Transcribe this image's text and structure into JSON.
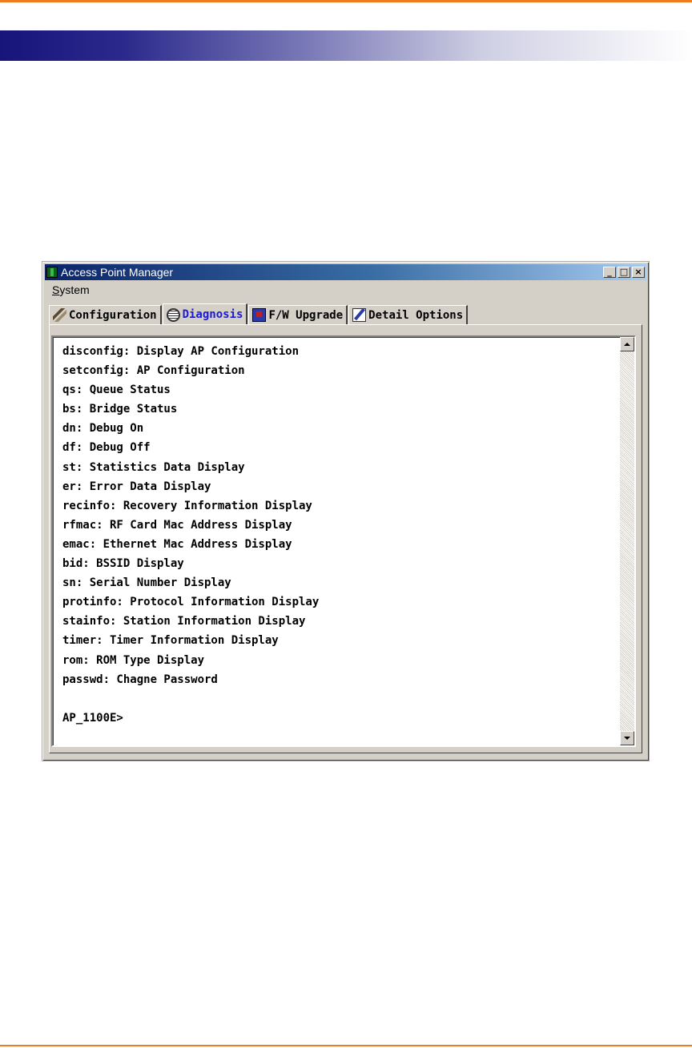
{
  "page": {
    "accent_color": "#f07a1f",
    "header_gradient_start": "#17147a"
  },
  "window": {
    "title": "Access Point Manager",
    "icon": "app-icon",
    "controls": [
      "minimize-icon",
      "maximize-icon",
      "close-icon"
    ]
  },
  "menu": {
    "system": {
      "accelerator": "S",
      "rest": "ystem"
    }
  },
  "tabs": [
    {
      "label": "Configuration",
      "icon": "wrench-icon",
      "active": false
    },
    {
      "label": "Diagnosis",
      "icon": "stethoscope-icon",
      "active": true
    },
    {
      "label": "F/W Upgrade",
      "icon": "firmware-icon",
      "active": false
    },
    {
      "label": "Detail Options",
      "icon": "notepad-icon",
      "active": false
    }
  ],
  "terminal": {
    "lines": [
      "disconfig: Display AP Configuration",
      "setconfig: AP Configuration",
      "qs: Queue Status",
      "bs: Bridge Status",
      "dn: Debug On",
      "df: Debug Off",
      "st: Statistics Data Display",
      "er: Error Data Display",
      "recinfo: Recovery Information Display",
      "rfmac: RF Card Mac Address Display",
      "emac: Ethernet Mac Address Display",
      "bid: BSSID Display",
      "sn: Serial Number Display",
      "protinfo: Protocol Information Display",
      "stainfo: Station Information Display",
      "timer: Timer Information Display",
      "rom: ROM Type Display",
      "passwd: Chagne Password"
    ],
    "prompt": "AP_1100E>"
  }
}
